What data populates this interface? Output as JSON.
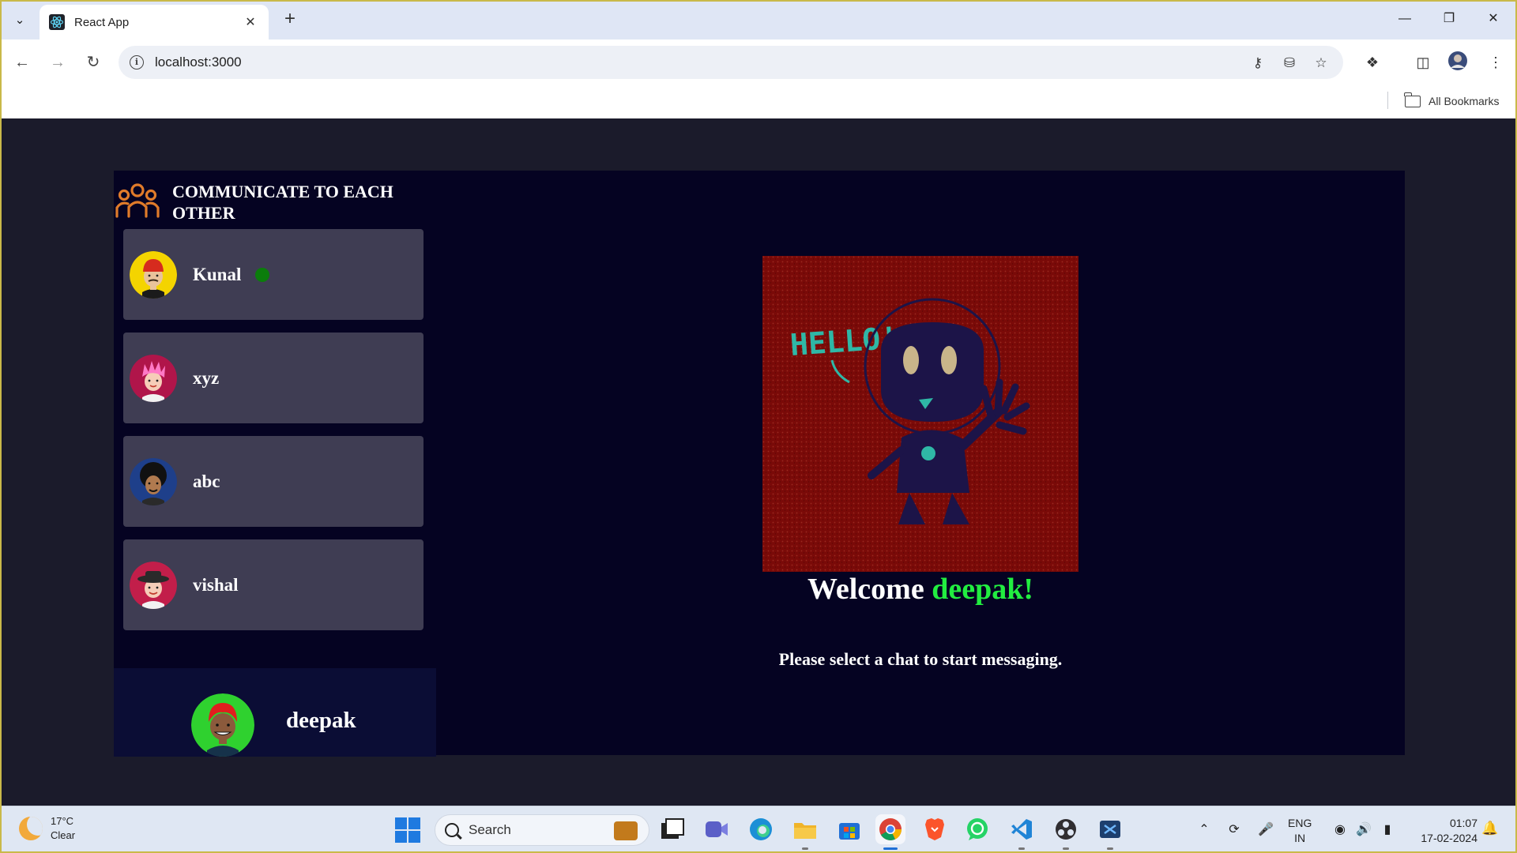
{
  "browser": {
    "tab_title": "React App",
    "url": "localhost:3000",
    "bookmarks_label": "All Bookmarks"
  },
  "sidebar": {
    "title_line1": "COMMUNICATE TO EACH",
    "title_line2": "OTHER",
    "users": [
      {
        "name": "Kunal",
        "online": true
      },
      {
        "name": "xyz",
        "online": false
      },
      {
        "name": "abc",
        "online": false
      },
      {
        "name": "vishal",
        "online": false
      }
    ],
    "current_user": "deepak"
  },
  "welcome": {
    "greeting": "Welcome",
    "name": "deepak!",
    "subtitle": "Please select a chat to start messaging.",
    "image_text": "HELLO!"
  },
  "taskbar": {
    "weather_temp": "17°C",
    "weather_desc": "Clear",
    "search_label": "Search",
    "lang_top": "ENG",
    "lang_bottom": "IN",
    "time": "01:07",
    "date": "17-02-2024"
  },
  "colors": {
    "page_bg": "#1b1b2b",
    "panel_bg": "#050322",
    "card_bg": "#3f3d53",
    "accent_orange": "#e07b2a",
    "welcome_name": "#22ee40",
    "online_green": "#0b7d0b"
  }
}
